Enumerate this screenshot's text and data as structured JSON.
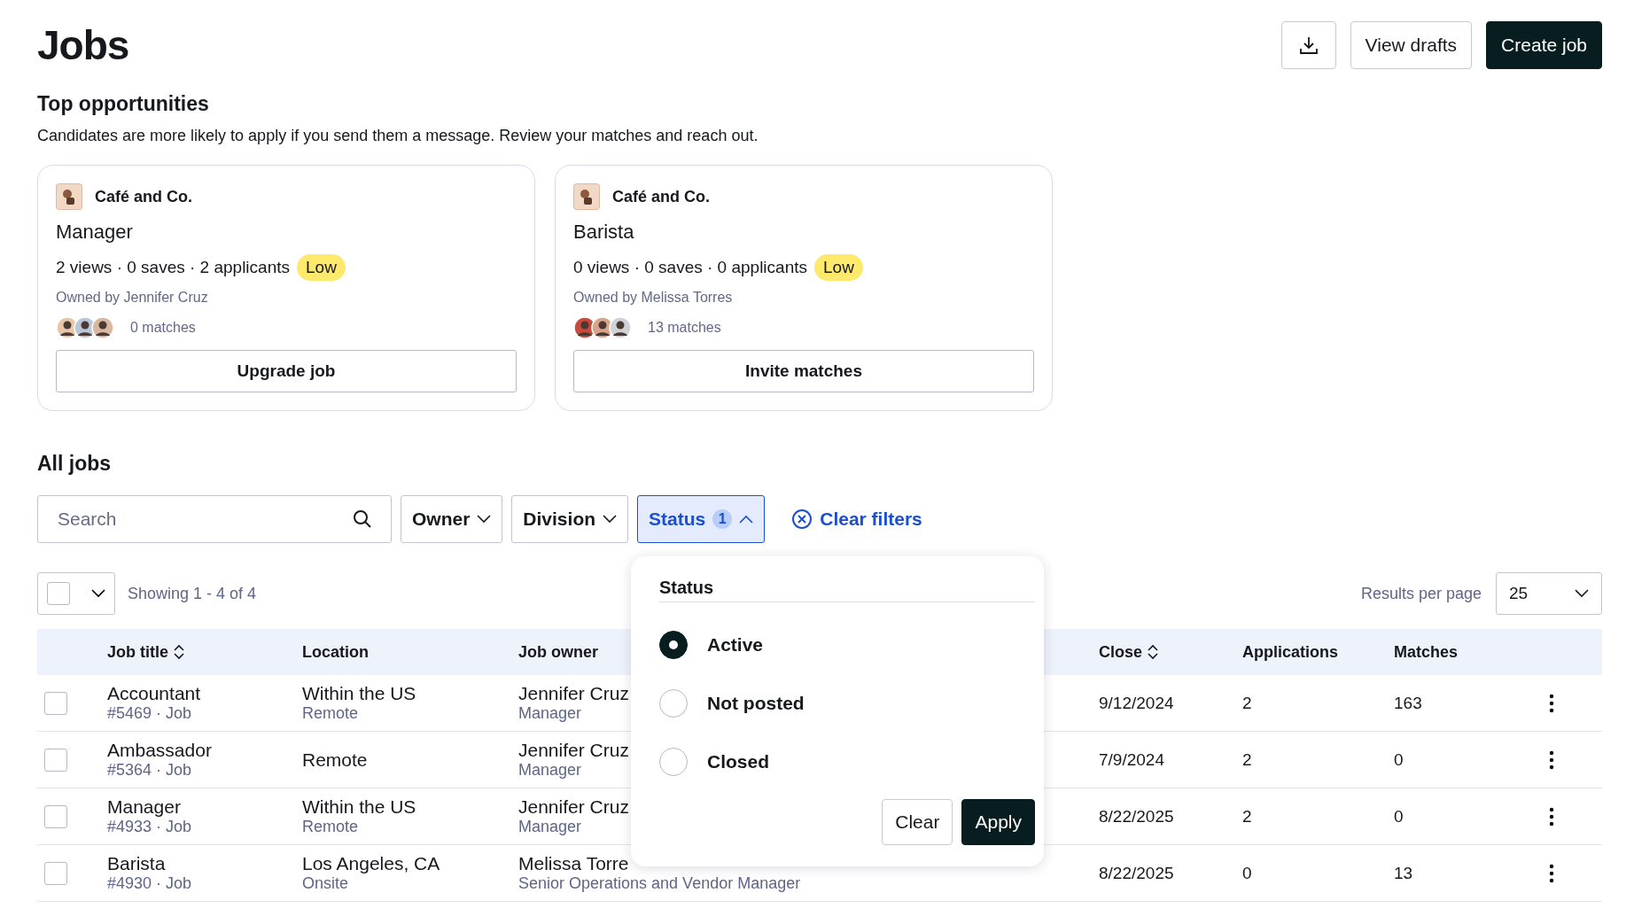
{
  "header": {
    "title": "Jobs",
    "buttons": [
      {
        "kind": "download"
      },
      {
        "kind": "secondary",
        "label": "View drafts"
      },
      {
        "kind": "primary",
        "label": "Create job"
      }
    ]
  },
  "top_opportunities": {
    "title": "Top opportunities",
    "description": "Candidates are more likely to apply if you send them a message. Review your matches and reach out.",
    "cards": [
      {
        "company": "Café and Co.",
        "title": "Manager",
        "stats": "2 views · 0 saves · 2 applicants",
        "badge": "Low",
        "owner": "Owned by Jennifer Cruz",
        "matches": "0 matches",
        "action": "Upgrade job"
      },
      {
        "company": "Café and Co.",
        "title": "Barista",
        "stats": "0 views · 0 saves · 0 applicants",
        "badge": "Low",
        "owner": "Owned by Melissa Torres",
        "matches": "13 matches",
        "action": "Invite matches"
      }
    ]
  },
  "all_jobs": {
    "title": "All jobs",
    "search": {
      "placeholder": "Search"
    },
    "filters": [
      {
        "label": "Owner",
        "active": false
      },
      {
        "label": "Division",
        "active": false
      },
      {
        "label": "Status",
        "active": true,
        "count": "1"
      }
    ],
    "clear_filters": "Clear filters",
    "showing": "Showing 1 - 4 of 4",
    "results_per_page": {
      "label": "Results per page",
      "value": "25"
    },
    "columns": [
      {
        "label": "Job title",
        "sortable": true
      },
      {
        "label": "Location",
        "sortable": false
      },
      {
        "label": "Job owner",
        "sortable": false
      },
      {
        "label": "Close",
        "sortable": true
      },
      {
        "label": "Applications",
        "sortable": false
      },
      {
        "label": "Matches",
        "sortable": false
      }
    ],
    "rows": [
      {
        "checked": false,
        "title": "Accountant",
        "sub": "#5469 · Job",
        "location": "Within the US",
        "location_sub": "Remote",
        "owner": "Jennifer Cruz",
        "owner_sub": "Manager",
        "close": "9/12/2024",
        "applications": "2",
        "matches": "163"
      },
      {
        "checked": false,
        "title": "Ambassador",
        "sub": "#5364 · Job",
        "location": "Remote",
        "owner": "Jennifer Cruz",
        "owner_sub": "Manager",
        "close": "7/9/2024",
        "applications": "2",
        "matches": "0"
      },
      {
        "checked": false,
        "title": "Manager",
        "sub": "#4933 · Job",
        "location": "Within the US",
        "location_sub": "Remote",
        "owner": "Jennifer Cruz",
        "owner_sub": "Manager",
        "close": "8/22/2025",
        "applications": "2",
        "matches": "0"
      },
      {
        "checked": false,
        "title": "Barista",
        "sub": "#4930 · Job",
        "location": "Los Angeles, CA",
        "location_sub": "Onsite",
        "owner": "Melissa Torre",
        "owner_sub": "Senior Operations and Vendor Manager",
        "close": "8/22/2025",
        "applications": "0",
        "matches": "13"
      }
    ],
    "status_popup": {
      "title": "Status",
      "options": [
        {
          "label": "Active",
          "selected": true
        },
        {
          "label": "Not posted",
          "selected": false
        },
        {
          "label": "Closed",
          "selected": false
        }
      ],
      "buttons": [
        {
          "kind": "secondary",
          "label": "Clear"
        },
        {
          "kind": "primary",
          "label": "Apply"
        }
      ]
    }
  }
}
